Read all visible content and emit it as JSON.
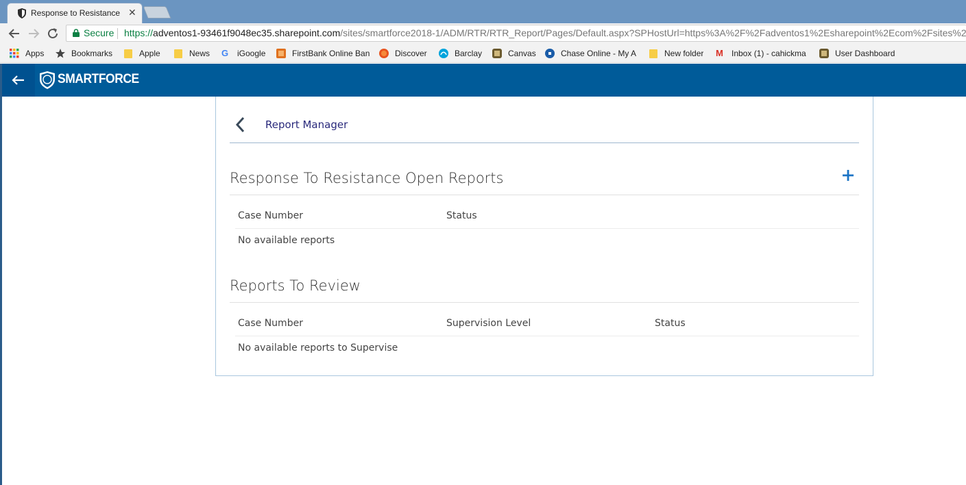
{
  "browser": {
    "tab_title": "Response to Resistance",
    "close_glyph": "✕",
    "secure_label": "Secure",
    "url_scheme": "https://",
    "url_host": "adventos1-93461f9048ec35.sharepoint.com",
    "url_path": "/sites/smartforce2018-1/ADM/RTR/RTR_Report/Pages/Default.aspx?SPHostUrl=https%3A%2F%2Fadventos1%2Esharepoint%2Ecom%2Fsites%2Fsma"
  },
  "bookmarks": [
    {
      "label": "Apps",
      "icon": "apps-grid-icon"
    },
    {
      "label": "Bookmarks",
      "icon": "star-icon"
    },
    {
      "label": "Apple",
      "icon": "folder-icon"
    },
    {
      "label": "News",
      "icon": "folder-icon"
    },
    {
      "label": "iGoogle",
      "icon": "google-icon"
    },
    {
      "label": "FirstBank Online Ban",
      "icon": "firstbank-icon"
    },
    {
      "label": "Discover",
      "icon": "discover-icon"
    },
    {
      "label": "Barclay",
      "icon": "barclay-icon"
    },
    {
      "label": "Canvas",
      "icon": "canvas-icon"
    },
    {
      "label": "Chase Online - My A",
      "icon": "chase-icon"
    },
    {
      "label": "New folder",
      "icon": "folder-icon"
    },
    {
      "label": "Inbox (1) - cahickma",
      "icon": "gmail-icon"
    },
    {
      "label": "User Dashboard",
      "icon": "dashboard-icon"
    }
  ],
  "app": {
    "brand": "SMARTFORCE",
    "breadcrumb_label": "Report Manager",
    "open_reports": {
      "title": "Response To Resistance Open Reports",
      "columns": [
        "Case Number",
        "Status"
      ],
      "empty_text": "No available reports"
    },
    "review_reports": {
      "title": "Reports To Review",
      "columns": [
        "Case Number",
        "Supervision Level",
        "Status"
      ],
      "empty_text": "No available reports to Supervise"
    }
  },
  "colors": {
    "header_blue": "#005b99",
    "accent_blue": "#1a73c5",
    "tabstrip": "#6b95c1"
  }
}
